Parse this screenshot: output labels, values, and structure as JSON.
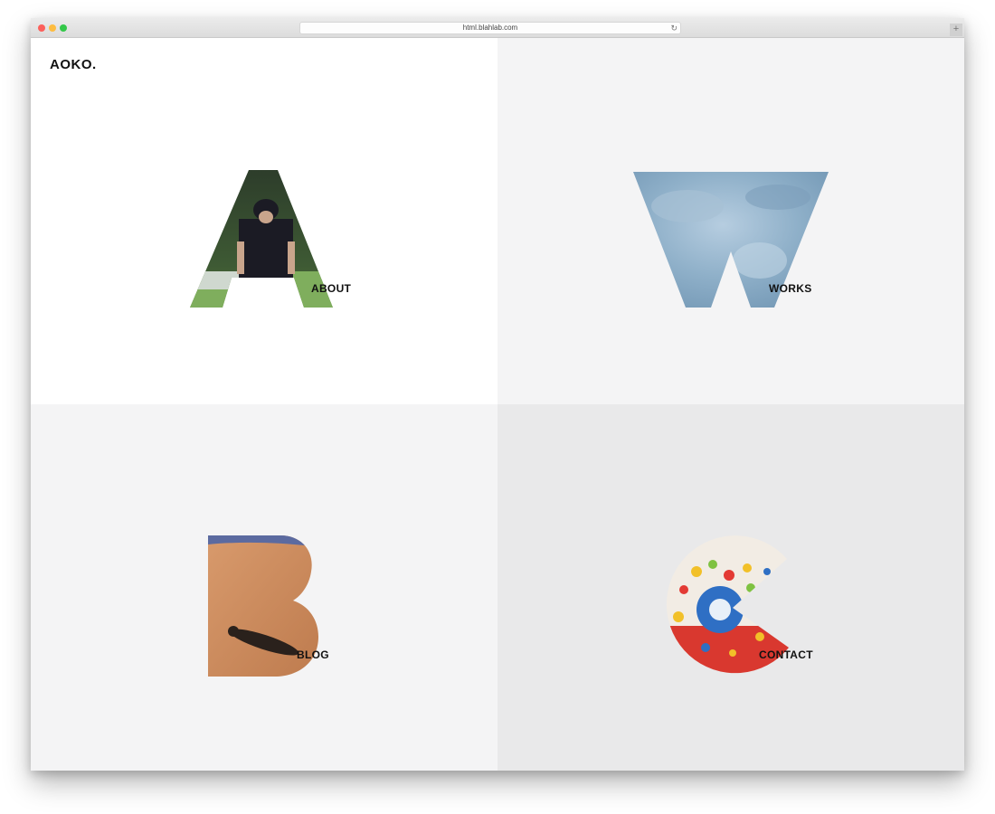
{
  "browser": {
    "url": "html.blahlab.com",
    "new_tab_label": "+"
  },
  "site": {
    "logo": "AOKO."
  },
  "panels": [
    {
      "label": "ABOUT",
      "letter_icon": "letter-a-photo-icon",
      "background": "#ffffff"
    },
    {
      "label": "WORKS",
      "letter_icon": "letter-w-photo-icon",
      "background": "#f4f4f5"
    },
    {
      "label": "BLOG",
      "letter_icon": "letter-b-photo-icon",
      "background": "#f4f4f5"
    },
    {
      "label": "CONTACT",
      "letter_icon": "letter-c-photo-icon",
      "background": "#e9e9ea"
    }
  ]
}
